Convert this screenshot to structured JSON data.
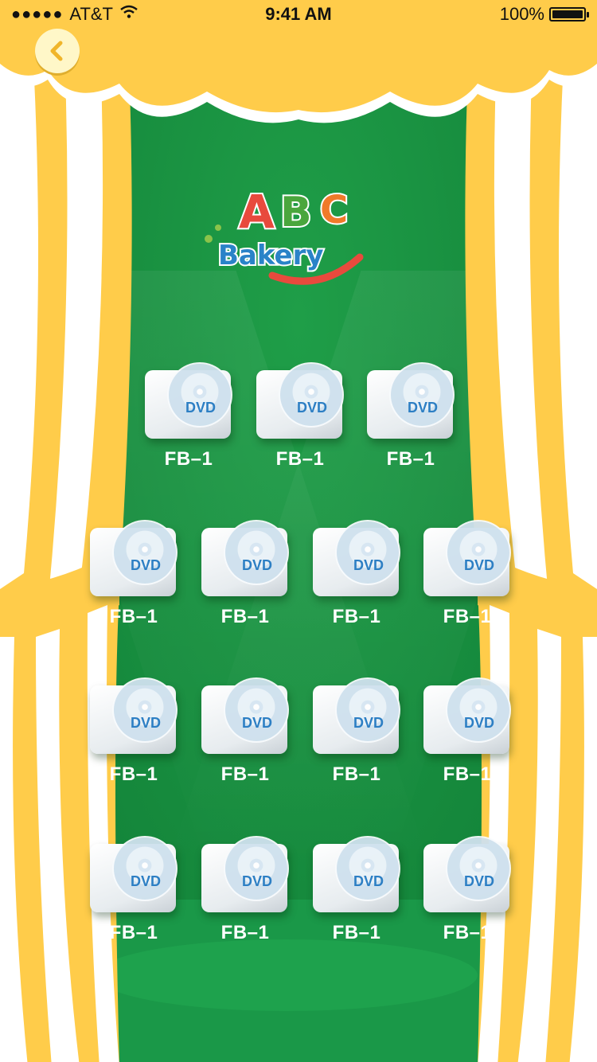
{
  "status_bar": {
    "carrier": "AT&T",
    "time": "9:41 AM",
    "battery_percent": "100%",
    "battery_level": 1.0
  },
  "logo": {
    "line1": "ABC",
    "line2": "Bakery"
  },
  "colors": {
    "stage_green": "#168a3d",
    "curtain_yellow": "#ffcc4a",
    "curtain_white": "#ffffff",
    "label_white": "#ffffff",
    "dvd_blue": "#2d7fc4"
  },
  "icons": {
    "back": "chevron-left-icon",
    "wifi": "wifi-icon",
    "signal": "signal-dots-icon",
    "battery": "battery-icon",
    "disc": "dvd-disc-icon"
  },
  "dvd_badge": "DVD",
  "rows": [
    {
      "items": [
        {
          "label": "FB–1"
        },
        {
          "label": "FB–1"
        },
        {
          "label": "FB–1"
        }
      ]
    },
    {
      "items": [
        {
          "label": "FB–1"
        },
        {
          "label": "FB–1"
        },
        {
          "label": "FB–1"
        },
        {
          "label": "FB–1"
        }
      ]
    },
    {
      "items": [
        {
          "label": "FB–1"
        },
        {
          "label": "FB–1"
        },
        {
          "label": "FB–1"
        },
        {
          "label": "FB–1"
        }
      ]
    },
    {
      "items": [
        {
          "label": "FB–1"
        },
        {
          "label": "FB–1"
        },
        {
          "label": "FB–1"
        },
        {
          "label": "FB–1"
        }
      ]
    }
  ]
}
